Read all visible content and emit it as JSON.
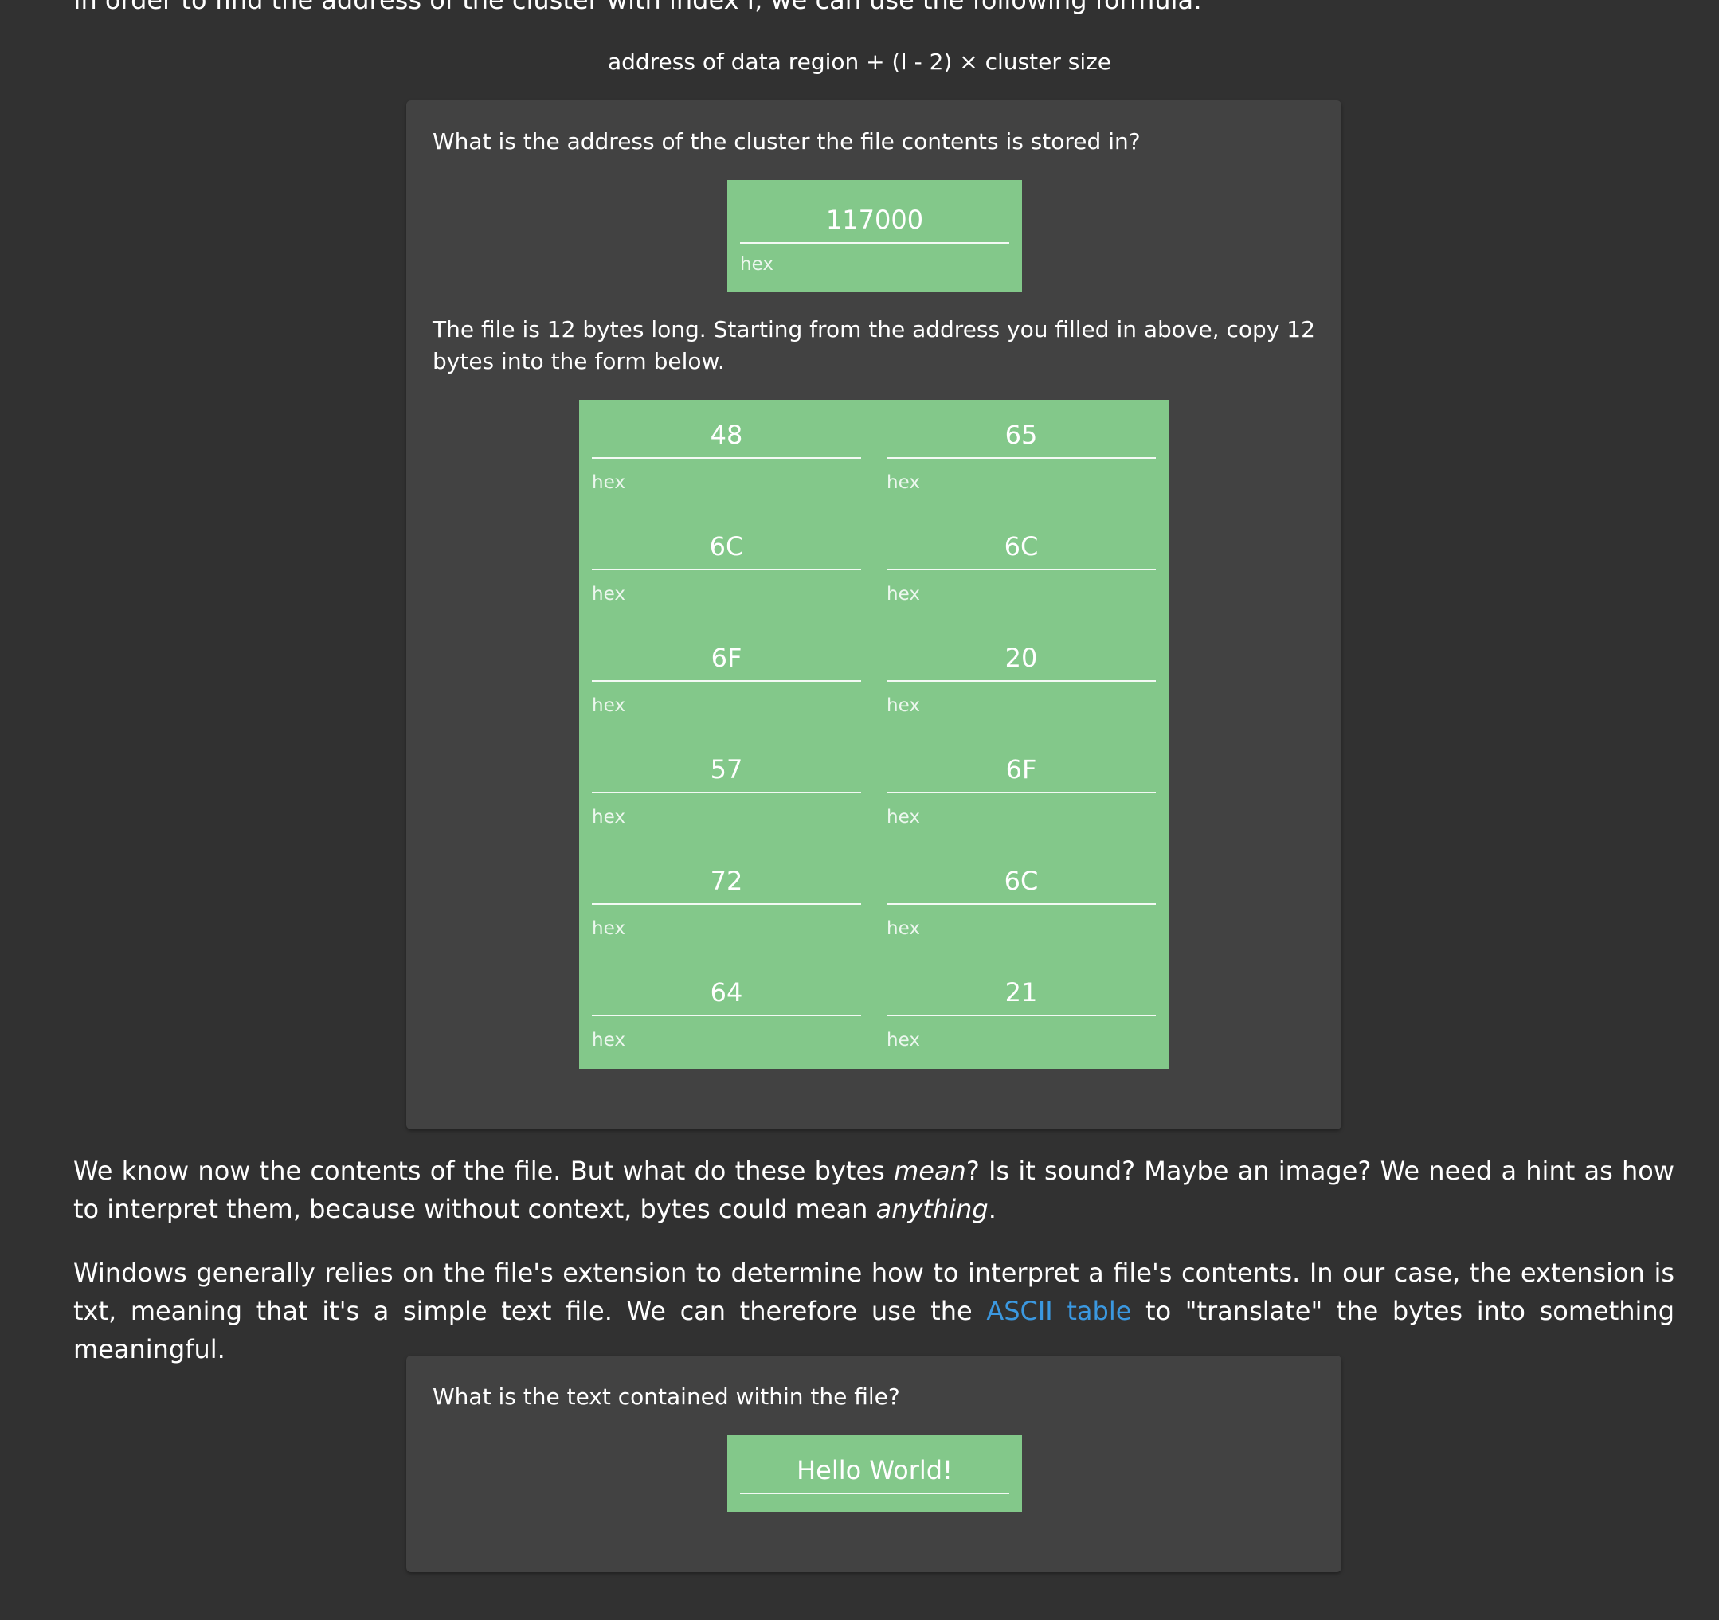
{
  "intro_text": "In order to find the address of the cluster with index I, we can use the following formula:",
  "formula": "address of data region + (I - 2) × cluster size",
  "cluster_card": {
    "question": "What is the address of the cluster the file contents is stored in?",
    "address_field": {
      "value": "117000",
      "label": "hex"
    },
    "instruction": "The file is 12 bytes long. Starting from the address you filled in above, copy 12 bytes into the form below.",
    "bytes": [
      {
        "value": "48",
        "label": "hex"
      },
      {
        "value": "65",
        "label": "hex"
      },
      {
        "value": "6C",
        "label": "hex"
      },
      {
        "value": "6C",
        "label": "hex"
      },
      {
        "value": "6F",
        "label": "hex"
      },
      {
        "value": "20",
        "label": "hex"
      },
      {
        "value": "57",
        "label": "hex"
      },
      {
        "value": "6F",
        "label": "hex"
      },
      {
        "value": "72",
        "label": "hex"
      },
      {
        "value": "6C",
        "label": "hex"
      },
      {
        "value": "64",
        "label": "hex"
      },
      {
        "value": "21",
        "label": "hex"
      }
    ]
  },
  "paragraph1": {
    "part1": "We know now the contents of the file. But what do these bytes ",
    "em1": "mean",
    "part2": "? Is it sound? Maybe an image? We need a hint as how to interpret them, because without context, bytes could mean ",
    "em2": "anything",
    "part3": "."
  },
  "paragraph2": {
    "part1": "Windows generally relies on the file's extension to determine how to interpret a file's contents. In our case, the extension is txt, meaning that it's a simple text file. We can therefore use the ",
    "link": "ASCII table",
    "part2": " to \"translate\" the bytes into something meaningful."
  },
  "text_card": {
    "question": "What is the text contained within the file?",
    "answer_field": {
      "value": "Hello World!"
    }
  },
  "colors": {
    "background": "#313131",
    "card": "#424242",
    "field": "#83c88a",
    "link": "#3b98e0"
  }
}
